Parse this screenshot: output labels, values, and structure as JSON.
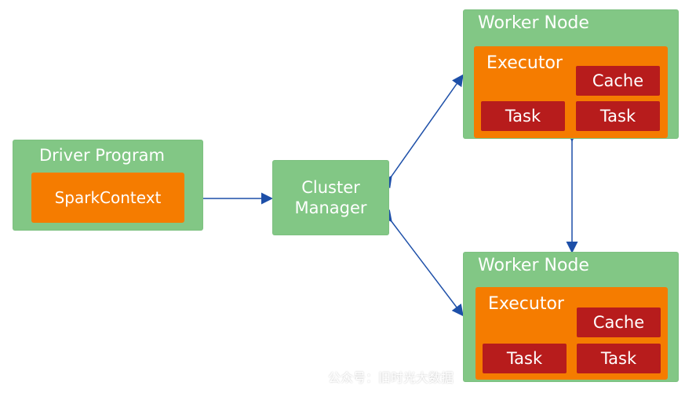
{
  "colors": {
    "green": "#82c785",
    "orange": "#f57c00",
    "red": "#b71c1c",
    "arrow": "#1d4fa8",
    "text": "#ffffff"
  },
  "driver": {
    "title": "Driver Program",
    "spark_context": "SparkContext"
  },
  "cluster_manager": {
    "line1": "Cluster",
    "line2": "Manager"
  },
  "worker_top": {
    "title": "Worker Node",
    "executor": "Executor",
    "cache": "Cache",
    "task_left": "Task",
    "task_right": "Task"
  },
  "worker_bottom": {
    "title": "Worker Node",
    "executor": "Executor",
    "cache": "Cache",
    "task_left": "Task",
    "task_right": "Task"
  },
  "watermark": "公众号：旧时光大数据"
}
